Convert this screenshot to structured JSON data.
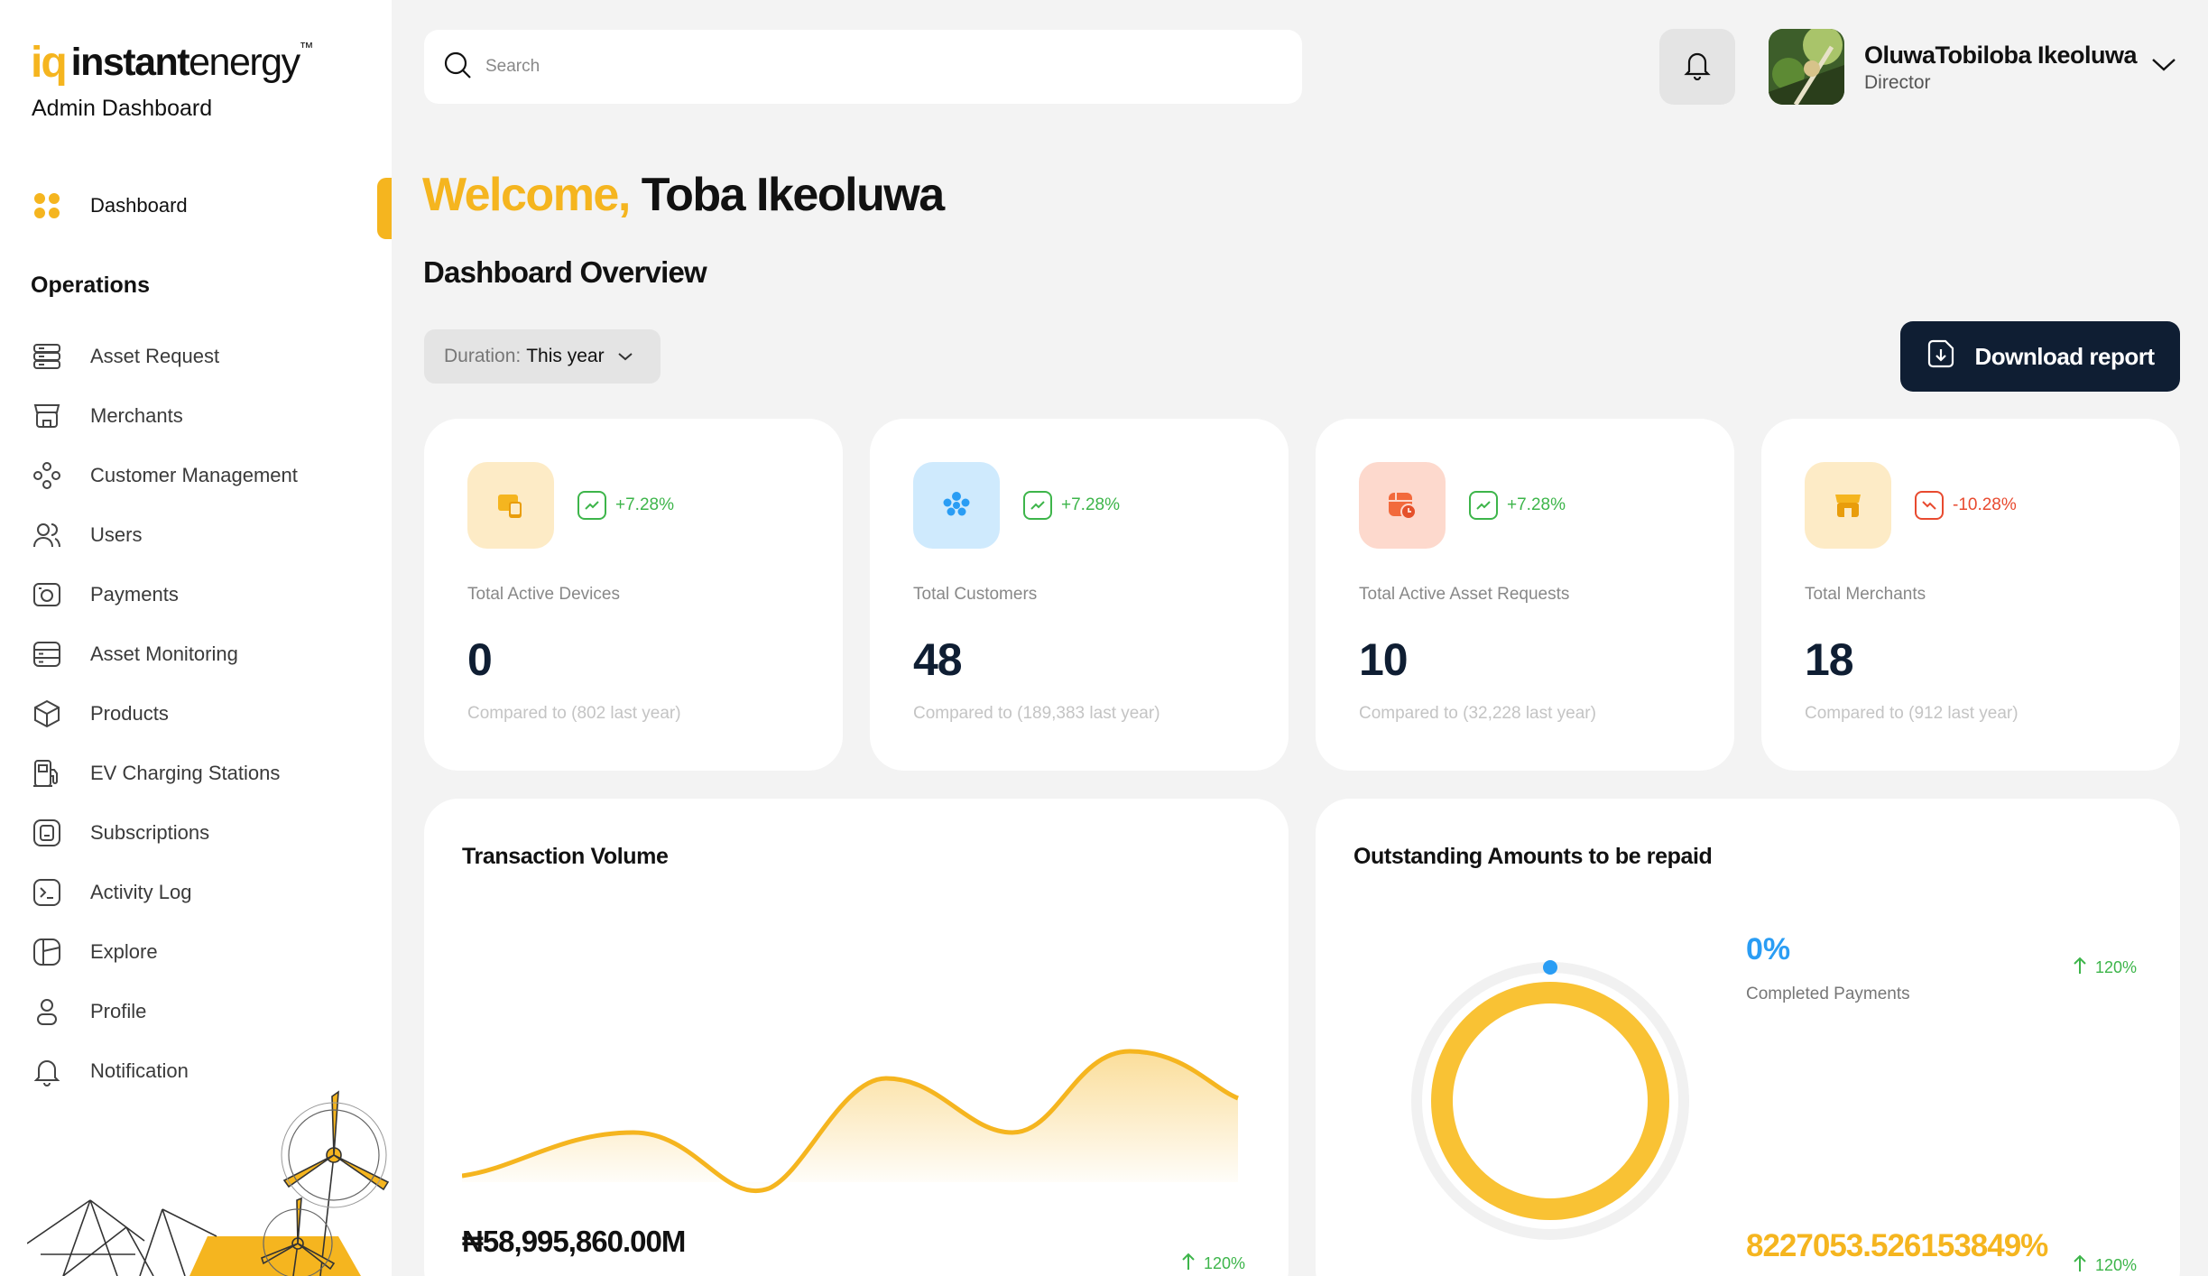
{
  "brand": {
    "mark": "iq",
    "name_bold": "instant",
    "name_light": "energy",
    "tm": "™",
    "subtitle": "Admin Dashboard"
  },
  "sidebar": {
    "active_item": {
      "label": "Dashboard",
      "icon": "grid-icon"
    },
    "section_title": "Operations",
    "items": [
      {
        "label": "Asset Request",
        "icon": "server-icon"
      },
      {
        "label": "Merchants",
        "icon": "storefront-icon"
      },
      {
        "label": "Customer Management",
        "icon": "people-group-icon"
      },
      {
        "label": "Users",
        "icon": "users-icon"
      },
      {
        "label": "Payments",
        "icon": "camera-payments-icon"
      },
      {
        "label": "Asset Monitoring",
        "icon": "monitor-list-icon"
      },
      {
        "label": "Products",
        "icon": "box-icon"
      },
      {
        "label": "EV Charging Stations",
        "icon": "fuel-station-icon"
      },
      {
        "label": "Subscriptions",
        "icon": "subscription-icon"
      },
      {
        "label": "Activity Log",
        "icon": "terminal-icon"
      },
      {
        "label": "Explore",
        "icon": "map-icon"
      },
      {
        "label": "Profile",
        "icon": "profile-icon"
      },
      {
        "label": "Notification",
        "icon": "bell-icon"
      }
    ]
  },
  "header": {
    "search_placeholder": "Search",
    "user_name": "OluwaTobiloba Ikeoluwa",
    "user_role": "Director"
  },
  "welcome": {
    "greeting": "Welcome,",
    "name": "Toba Ikeoluwa"
  },
  "overview_title": "Dashboard Overview",
  "duration": {
    "label": "Duration:",
    "value": "This year"
  },
  "download_label": "Download report",
  "stats": [
    {
      "label": "Total Active Devices",
      "value": "0",
      "change": "+7.28%",
      "trend": "up",
      "compare": "Compared to (802 last year)",
      "icon": "devices-icon",
      "color": "#f5b51f",
      "bg": "#fdebc6"
    },
    {
      "label": "Total Customers",
      "value": "48",
      "change": "+7.28%",
      "trend": "up",
      "compare": "Compared to (189,383 last year)",
      "icon": "customers-icon",
      "color": "#2a9df4",
      "bg": "#cfeafd"
    },
    {
      "label": "Total Active Asset Requests",
      "value": "10",
      "change": "+7.28%",
      "trend": "up",
      "compare": "Compared to (32,228 last year)",
      "icon": "asset-request-icon",
      "color": "#f26a3c",
      "bg": "#fdd9cd"
    },
    {
      "label": "Total Merchants",
      "value": "18",
      "change": "-10.28%",
      "trend": "down",
      "compare": "Compared to (912 last year)",
      "icon": "merchant-icon",
      "color": "#f5b51f",
      "bg": "#fdebc6"
    }
  ],
  "transaction_volume": {
    "title": "Transaction Volume",
    "amount": "₦58,995,860.00M",
    "change": "120%"
  },
  "outstanding": {
    "title": "Outstanding Amounts to be repaid",
    "completed_pct": "0%",
    "completed_label": "Completed Payments",
    "completed_change": "120%",
    "outstanding_pct": "8227053.526153849%",
    "outstanding_change": "120%"
  },
  "colors": {
    "accent": "#f5b51f",
    "navy": "#0f1e33",
    "up": "#3db54a",
    "down": "#e84a2f",
    "blue": "#2a9df4"
  }
}
